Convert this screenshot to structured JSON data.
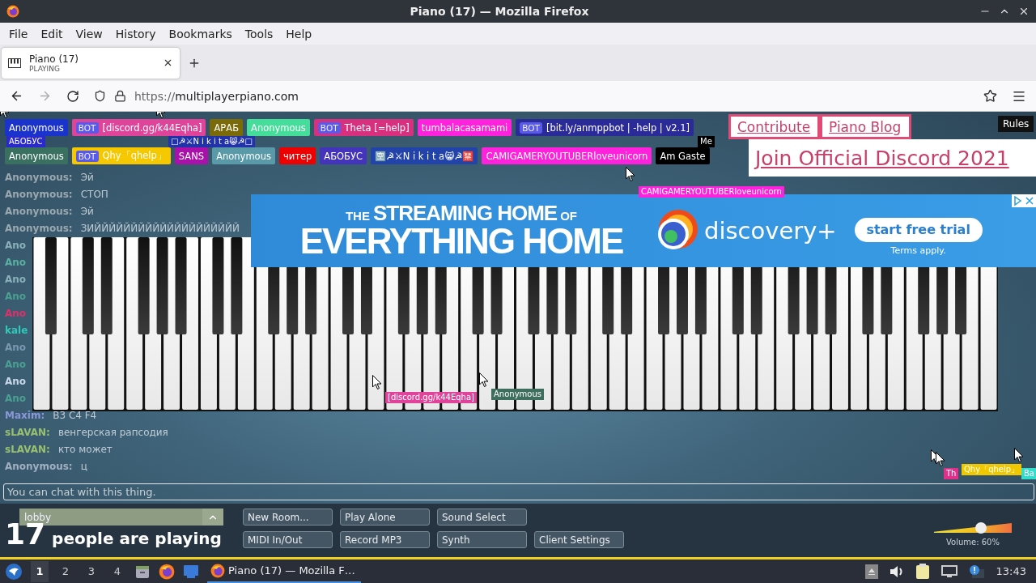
{
  "window": {
    "title": "Piano (17) — Mozilla Firefox"
  },
  "menu": [
    "File",
    "Edit",
    "View",
    "History",
    "Bookmarks",
    "Tools",
    "Help"
  ],
  "tabs": [
    {
      "title": "Piano (17)",
      "status": "PLAYING",
      "selected": true
    }
  ],
  "nav": {
    "back_disabled": false,
    "forward_disabled": true
  },
  "address_bar": {
    "scheme": "https://",
    "host": "multiplayerpiano.com"
  },
  "participant_rows": [
    [
      {
        "name": "Anonymous",
        "color": "#1a33cc"
      },
      {
        "badge": "BOT",
        "name": "[discord.gg/k44Eqha]",
        "color": "#e0449a"
      },
      {
        "name": "АРАБ",
        "color": "#7a6a08"
      },
      {
        "name": "Anonymous",
        "color": "#44dd99"
      },
      {
        "badge": "BOT",
        "name": "Theta [=help]",
        "color": "#d8307f"
      },
      {
        "name": "tumbalacasamami",
        "color": "#ff22dd"
      },
      {
        "badge": "BOT",
        "name": "[bit.ly/anmppbot | -help | v2.1]",
        "color": "#2a2a99"
      }
    ],
    [
      {
        "name": "Anonymous",
        "color": "#3a7060"
      },
      {
        "badge": "BOT",
        "name": "Qhy「qhelp」",
        "color": "#f5c800"
      },
      {
        "name": "SANS",
        "color": "#aa10aa"
      },
      {
        "name": "Anonymous",
        "color": "#5a9aa8"
      },
      {
        "name": "читер",
        "color": "#ee0000"
      },
      {
        "name": "АБОБУС",
        "color": "#4433bb"
      },
      {
        "name": "🈳☭⚔N i k i t a😸☭🈲",
        "color": "#2244aa"
      },
      {
        "name": "CAMIGAMERYOUTUBERloveunicorn",
        "color": "#ff22dd"
      },
      {
        "name": "Am Gaste",
        "color": "#000000"
      }
    ]
  ],
  "overlay_tags": [
    {
      "name": "АБОБУС",
      "color": "#2a2acc"
    },
    {
      "name": "□☭⚔N i k i t a😸☭□",
      "color": "#2233aa"
    },
    {
      "name": "Me",
      "color": "#000000"
    }
  ],
  "links": [
    "Contribute",
    "Piano Blog"
  ],
  "discord_banner": "Join Official Discord 2021",
  "rules_button": "Rules",
  "chat": [
    {
      "name": "Anonymous:",
      "text": "Эй",
      "color": "#9aa8b0"
    },
    {
      "name": "Anonymous:",
      "text": "СТОП",
      "color": "#9aa8b0"
    },
    {
      "name": "Anonymous:",
      "text": "Эй",
      "color": "#9aa8b0"
    },
    {
      "name": "Anonymous:",
      "text": "ЗИЙЙЙЙЙЙЙЙЙЙЙЙЙЙЙЙЙЙЙЙ",
      "color": "#9aa8b0"
    },
    {
      "name": "Ano",
      "color": "#8ab0b8"
    },
    {
      "name": "Ano",
      "color": "#5ab0a0"
    },
    {
      "name": "Ano",
      "color": "#8ab0b8"
    },
    {
      "name": "Ano",
      "color": "#4aa090"
    },
    {
      "name": "Ano",
      "color": "#e0306a"
    },
    {
      "name": "kale",
      "color": "#30c8b8"
    },
    {
      "name": "Ano",
      "color": "#7a98b0"
    },
    {
      "name": "Ano",
      "color": "#4aa090"
    },
    {
      "name": "Ano",
      "color": "#c8d8e8"
    },
    {
      "name": "Ano",
      "color": "#4aa090"
    },
    {
      "name": "Maxim:",
      "text": "B3 C4 F4",
      "color": "#8898d8"
    },
    {
      "name": "sLAVAN:",
      "text": "венгерская рапсодия",
      "color": "#98c070"
    },
    {
      "name": "sLAVAN:",
      "text": "кто может",
      "color": "#98c070"
    },
    {
      "name": "Anonymous:",
      "text": "ц",
      "color": "#a0b0c0"
    }
  ],
  "ad": {
    "small_1": "THE",
    "headline_1": "STREAMING HOME",
    "small_2": "OF",
    "headline_2": "EVERYTHING HOME",
    "brand": "discovery+",
    "cta": "start free trial",
    "note": "Terms apply."
  },
  "cursor_labels": [
    {
      "name": "CAMIGAMERYOUTUBERloveunicorn",
      "color": "#ff22dd"
    },
    {
      "name": "[discord.gg/k44Eqha]",
      "color": "#e0449a"
    },
    {
      "name": "Anonymous",
      "color": "#3d6e5e"
    },
    {
      "name": "Th",
      "color": "#e0308a"
    },
    {
      "name": "Qhy「qhelp」",
      "color": "#f0c800"
    },
    {
      "name": "Ba",
      "color": "#33ddcc"
    }
  ],
  "chat_input": {
    "placeholder": "You can chat with this thing."
  },
  "room": {
    "name": "lobby"
  },
  "player_count": "17",
  "player_label": "people are playing",
  "buttons": [
    [
      "New Room...",
      "Play Alone",
      "Sound Select"
    ],
    [
      "MIDI In/Out",
      "Record MP3",
      "Synth",
      "Client Settings"
    ]
  ],
  "volume": {
    "level": 0.6,
    "label": "Volume: 60%"
  },
  "taskbar": {
    "workspaces": [
      {
        "label": "1",
        "selected": true
      },
      {
        "label": "2",
        "selected": false
      },
      {
        "label": "3",
        "selected": false
      },
      {
        "label": "4",
        "selected": false
      }
    ],
    "tasks": [
      {
        "title": "Piano (17) — Mozilla F…",
        "selected": true
      }
    ],
    "clock": "13:43"
  }
}
